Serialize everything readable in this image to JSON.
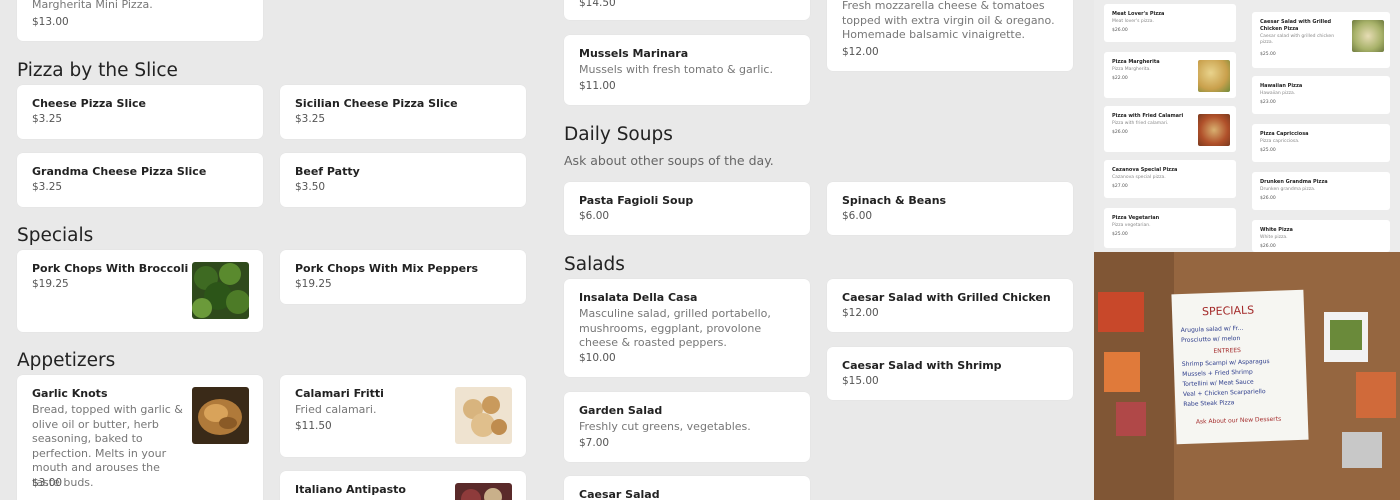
{
  "panel1": {
    "top_card": {
      "desc": "Margherita Mini Pizza.",
      "price": "$13.00"
    },
    "sections": {
      "slice": "Pizza by the Slice",
      "specials": "Specials",
      "appetizers": "Appetizers"
    },
    "items": [
      {
        "name": "Cheese Pizza Slice",
        "price": "$3.25"
      },
      {
        "name": "Sicilian Cheese Pizza Slice",
        "price": "$3.25"
      },
      {
        "name": "Grandma Cheese Pizza Slice",
        "price": "$3.25"
      },
      {
        "name": "Beef Patty",
        "price": "$3.50"
      },
      {
        "name": "Pork Chops With Broccoli Rabe",
        "price": "$19.25"
      },
      {
        "name": "Pork Chops With Mix Peppers",
        "price": "$19.25"
      },
      {
        "name": "Garlic Knots",
        "desc": "Bread, topped with garlic & olive oil or butter, herb seasoning, baked to perfection. Melts in your mouth and arouses the taste buds.",
        "price": "$3.00"
      },
      {
        "name": "Calamari Fritti",
        "desc": "Fried calamari.",
        "price": "$11.50"
      },
      {
        "name": "Italiano Antipasto"
      }
    ]
  },
  "panel2": {
    "top_left_price": "$14.50",
    "top_right_desc": "Fresh mozzarella cheese & tomatoes topped with extra virgin oil & oregano. Homemade balsamic vinaigrette.",
    "top_right_price": "$12.00",
    "mussels": {
      "name": "Mussels Marinara",
      "desc": "Mussels with fresh tomato & garlic.",
      "price": "$11.00"
    },
    "sections": {
      "soups": "Daily Soups",
      "soups_note": "Ask about other soups of the day.",
      "salads": "Salads"
    },
    "soups": [
      {
        "name": "Pasta Fagioli Soup",
        "price": "$6.00"
      },
      {
        "name": "Spinach & Beans",
        "price": "$6.00"
      }
    ],
    "salads": [
      {
        "name": "Insalata Della Casa",
        "desc": "Masculine salad, grilled portabello, mushrooms, eggplant, provolone cheese & roasted peppers.",
        "price": "$10.00"
      },
      {
        "name": "Caesar Salad with Grilled Chicken",
        "price": "$12.00"
      },
      {
        "name": "Caesar Salad with Shrimp",
        "price": "$15.00"
      },
      {
        "name": "Garden Salad",
        "desc": "Freshly cut greens, vegetables.",
        "price": "$7.00"
      },
      {
        "name": "Caesar Salad"
      }
    ]
  },
  "panel3": {
    "cards": [
      {
        "name": "Meat Lover's Pizza",
        "desc": "Meat lover's pizza.",
        "price": "$26.00"
      },
      {
        "name": "Caesar Salad with Grilled Chicken Pizza",
        "desc": "Caesar salad with grilled chicken pizza.",
        "price": "$25.00"
      },
      {
        "name": "Pizza Margherita",
        "desc": "Pizza Margherita.",
        "price": "$22.00"
      },
      {
        "name": "Hawaiian Pizza",
        "desc": "Hawaiian pizza.",
        "price": "$23.00"
      },
      {
        "name": "Pizza with Fried Calamari",
        "desc": "Pizza with fried calamari.",
        "price": "$26.00"
      },
      {
        "name": "Pizza Capricciosa",
        "desc": "Pizza capricciosa.",
        "price": "$25.00"
      },
      {
        "name": "Cazanova Special Pizza",
        "desc": "Cazanova special pizza.",
        "price": "$27.00"
      },
      {
        "name": "Drunken Grandma Pizza",
        "desc": "Drunken grandma pizza.",
        "price": "$26.00"
      },
      {
        "name": "Pizza Vegetarian",
        "desc": "Pizza vegetarian.",
        "price": "$25.00"
      },
      {
        "name": "White Pizza",
        "desc": "White pizza.",
        "price": "$26.00"
      }
    ],
    "board": {
      "title": "SPECIALS",
      "lines": [
        "Arugula salad w/ Fr...",
        "Prosciutto w/ melon",
        "ENTREES",
        "Shrimp Scampi w/ Asparagus",
        "Mussels + Fried Shrimp",
        "Tortellini w/ Meat Sauce",
        "Veal + Chicken Scarpariello",
        "Rabe Steak Pizza",
        "Ask About our New Desserts"
      ]
    }
  }
}
